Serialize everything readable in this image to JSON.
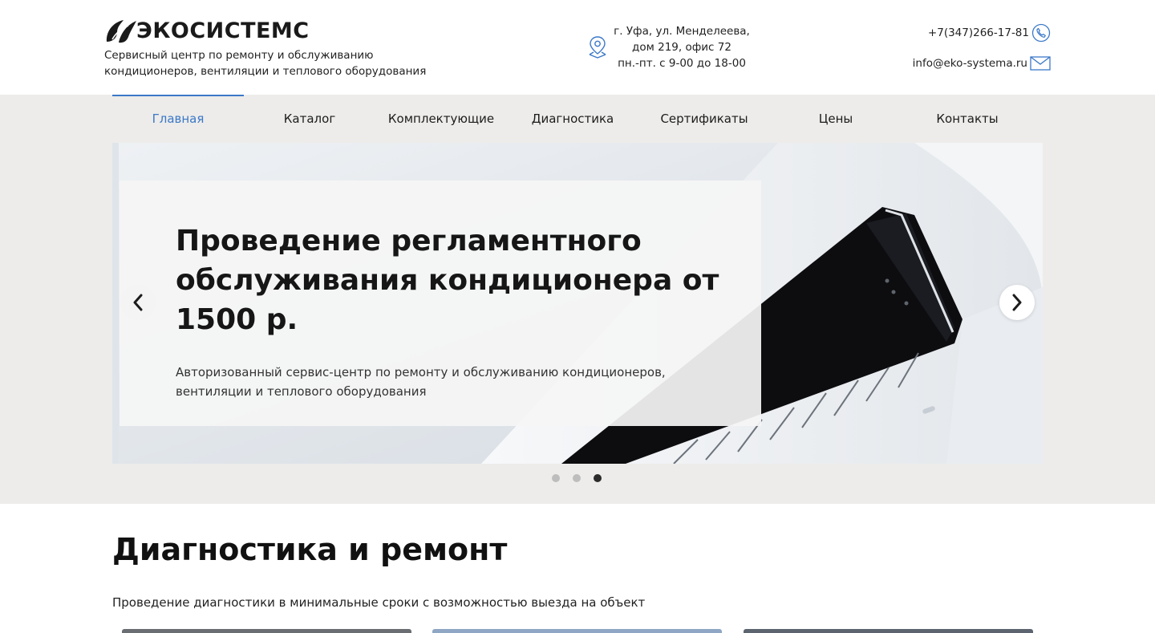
{
  "brand": {
    "name": "ЭКОСИСТЕМС",
    "tagline": "Сервисный центр по ремонту и обслуживанию кондиционеров, вентиляции и теплового оборудования",
    "logo_icon": "stylized-leaf-logo-icon"
  },
  "header": {
    "address_lines": [
      "г. Уфа, ул. Менделеева,",
      "дом 219, офис 72",
      "пн.-пт. с 9-00 до 18-00"
    ],
    "phone": "+7(347)266-17-81",
    "email": "info@eko-systema.ru",
    "icons": {
      "address": "map-pin-icon",
      "phone": "phone-icon",
      "email": "envelope-icon"
    },
    "accent_color": "#3b78c8"
  },
  "nav": {
    "items": [
      {
        "label": "Главная",
        "active": true
      },
      {
        "label": "Каталог",
        "active": false
      },
      {
        "label": "Комплектующие",
        "active": false
      },
      {
        "label": "Диагностика",
        "active": false
      },
      {
        "label": "Сертификаты",
        "active": false
      },
      {
        "label": "Цены",
        "active": false
      },
      {
        "label": "Контакты",
        "active": false
      }
    ]
  },
  "slider": {
    "title": "Проведение регламентного обслуживания кондиционера от 1500 р.",
    "subtitle": "Авторизованный сервис-центр по ремонту и обслуживанию кондиционеров, вентиляции и теплового оборудования",
    "prev_icon": "chevron-left-icon",
    "next_icon": "chevron-right-icon",
    "dots_count": 3,
    "active_dot": 3
  },
  "section": {
    "title": "Диагностика и ремонт",
    "subtitle": "Проведение диагностики в минимальные сроки с возможностью выезда на объект"
  }
}
